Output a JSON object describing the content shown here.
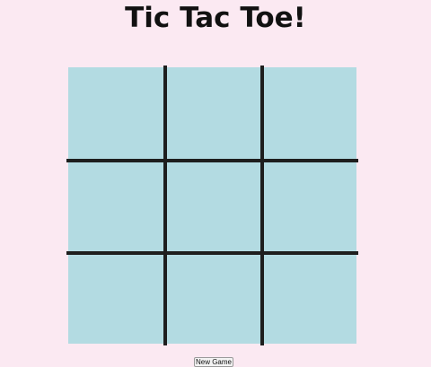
{
  "title": "Tic Tac Toe!",
  "board": {
    "rows": 3,
    "cols": 3,
    "cells": [
      "",
      "",
      "",
      "",
      "",
      "",
      "",
      "",
      ""
    ],
    "cell_color": "#b3dbe2",
    "line_color": "#1e1e1e"
  },
  "background_color": "#fbe9f2",
  "controls": {
    "new_game_label": "New Game"
  }
}
